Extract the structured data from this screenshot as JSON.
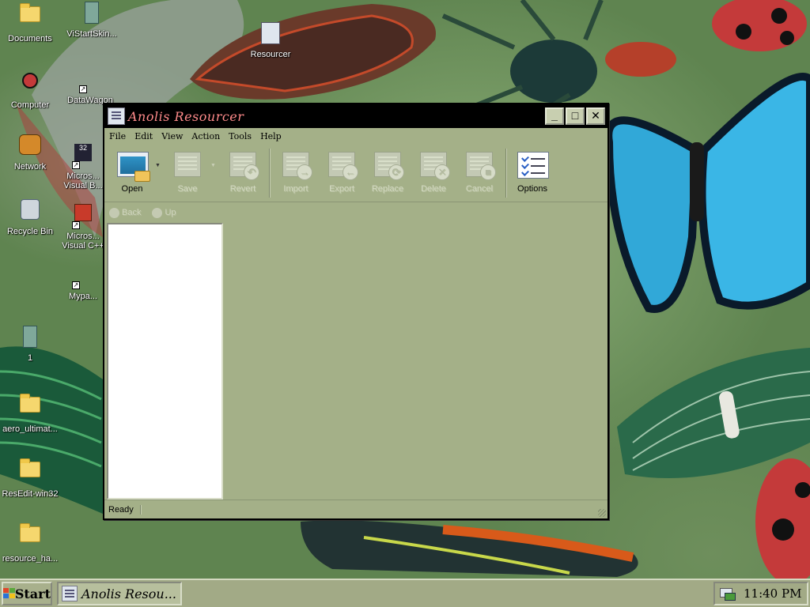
{
  "desktop": {
    "icons": [
      {
        "label": "Documents",
        "icon": "documents-folder-icon"
      },
      {
        "label": "ViStartSkin...",
        "icon": "file-icon"
      },
      {
        "label": "Resourcer",
        "icon": "resourcer-icon"
      },
      {
        "label": "Computer",
        "icon": "computer-icon"
      },
      {
        "label": "DataWagon",
        "icon": "datawagon-icon"
      },
      {
        "label": "Network",
        "icon": "network-icon"
      },
      {
        "label": "Micros... Visual B...",
        "icon": "vb-icon"
      },
      {
        "label": "Recycle Bin",
        "icon": "recycle-bin-icon"
      },
      {
        "label": "Micros... Visual C++",
        "icon": "vc-icon"
      },
      {
        "label": "Mypa...",
        "icon": "mypa-icon"
      },
      {
        "label": "1",
        "icon": "file-icon"
      },
      {
        "label": "aero_ultimat...",
        "icon": "folder-icon"
      },
      {
        "label": "ResEdit-win32",
        "icon": "folder-icon"
      },
      {
        "label": "resource_ha...",
        "icon": "folder-icon"
      }
    ]
  },
  "window": {
    "title": "Anolis Resourcer",
    "controls": {
      "minimize": "_",
      "maximize": "□",
      "close": "✕"
    },
    "menu": [
      "File",
      "Edit",
      "View",
      "Action",
      "Tools",
      "Help"
    ],
    "toolbar": {
      "open": "Open",
      "save": "Save",
      "revert": "Revert",
      "import": "Import",
      "export": "Export",
      "replace": "Replace",
      "delete": "Delete",
      "cancel": "Cancel",
      "options": "Options"
    },
    "nav": {
      "back": "Back",
      "up": "Up"
    },
    "status": "Ready"
  },
  "taskbar": {
    "start": "Start",
    "app_title": "Anolis Resou...",
    "clock": "11:40 PM"
  },
  "colors": {
    "window_bg": "#a4b088",
    "titlebar_bg": "#000000",
    "title_text": "#ff8b8b",
    "taskbar_bg": "#a2aa86"
  }
}
